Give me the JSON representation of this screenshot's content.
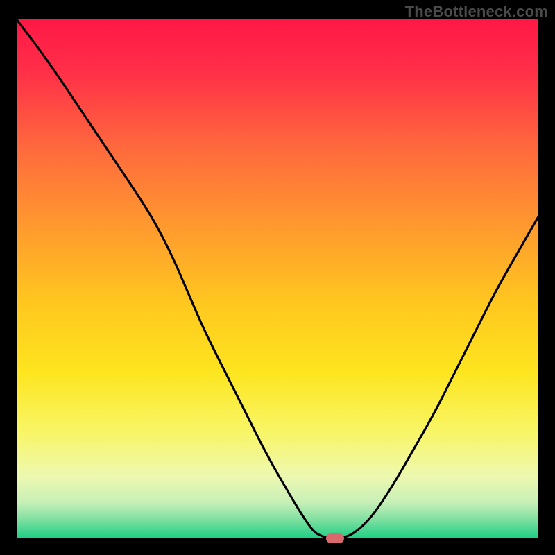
{
  "watermark": "TheBottleneck.com",
  "chart_data": {
    "type": "line",
    "title": "",
    "xlabel": "",
    "ylabel": "",
    "xlim": [
      0,
      100
    ],
    "ylim": [
      0,
      100
    ],
    "grid": false,
    "legend": false,
    "x": [
      0,
      6,
      12,
      18,
      24,
      27,
      30,
      33,
      36,
      40,
      44,
      48,
      52,
      55,
      57,
      58.5,
      60,
      61,
      63,
      65,
      68,
      72,
      76,
      80,
      84,
      88,
      92,
      96,
      100
    ],
    "y": [
      100,
      92,
      83,
      74,
      65,
      60,
      54,
      47,
      40,
      32,
      24,
      16,
      9,
      4,
      1.2,
      0.4,
      0,
      0,
      0.2,
      1.2,
      4,
      10,
      17,
      24,
      32,
      40,
      48,
      55,
      62
    ],
    "marker": {
      "x": 61,
      "y": 0
    },
    "background_gradient": {
      "stops": [
        {
          "offset": 0.0,
          "color": "#ff1846"
        },
        {
          "offset": 0.1,
          "color": "#ff2f48"
        },
        {
          "offset": 0.25,
          "color": "#ff6a3d"
        },
        {
          "offset": 0.4,
          "color": "#ff9a2e"
        },
        {
          "offset": 0.55,
          "color": "#ffc81f"
        },
        {
          "offset": 0.68,
          "color": "#fde51f"
        },
        {
          "offset": 0.8,
          "color": "#f8f66a"
        },
        {
          "offset": 0.88,
          "color": "#edf8b0"
        },
        {
          "offset": 0.93,
          "color": "#c8f0b8"
        },
        {
          "offset": 0.965,
          "color": "#7cdfa0"
        },
        {
          "offset": 1.0,
          "color": "#1dcf84"
        }
      ]
    }
  }
}
